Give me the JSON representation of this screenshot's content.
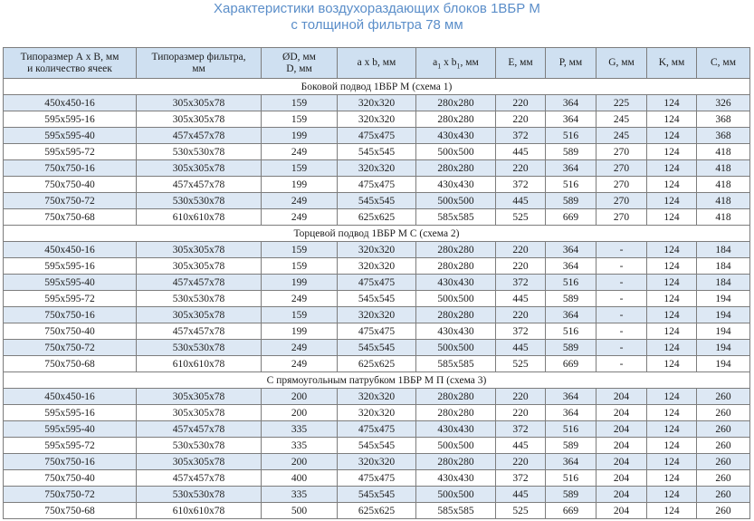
{
  "title": {
    "line1": "Характеристики воздухораздающих блоков 1ВБР М",
    "line2": "с толщиной фильтра 78 мм"
  },
  "colors": {
    "title": "#5b8ec9",
    "header_bg": "#cfe0f1",
    "stripe_bg": "#dde8f4",
    "border": "#7d7d7d"
  },
  "headers": {
    "size_line1": "Типоразмер А х В, мм",
    "size_line2": "и количество ячеек",
    "filter_line1": "Типоразмер фильтра,",
    "filter_line2": "мм",
    "d_line1": "ØD, мм",
    "d_line2": "D, мм",
    "ab": "a x b, мм",
    "a1b1_a": "a",
    "a1b1_sub1": "1",
    "a1b1_mid": " x b",
    "a1b1_sub2": "1",
    "a1b1_end": ", мм",
    "e": "E, мм",
    "p": "P, мм",
    "g": "G, мм",
    "k": "K, мм",
    "c": "C, мм"
  },
  "sections": [
    {
      "title": "Боковой подвод 1ВБР М (схема 1)",
      "rows": [
        [
          "450x450-16",
          "305x305x78",
          "159",
          "320x320",
          "280x280",
          "220",
          "364",
          "225",
          "124",
          "326"
        ],
        [
          "595x595-16",
          "305x305x78",
          "159",
          "320x320",
          "280x280",
          "220",
          "364",
          "245",
          "124",
          "368"
        ],
        [
          "595x595-40",
          "457x457x78",
          "199",
          "475x475",
          "430x430",
          "372",
          "516",
          "245",
          "124",
          "368"
        ],
        [
          "595x595-72",
          "530x530x78",
          "249",
          "545x545",
          "500x500",
          "445",
          "589",
          "270",
          "124",
          "418"
        ],
        [
          "750x750-16",
          "305x305x78",
          "159",
          "320x320",
          "280x280",
          "220",
          "364",
          "270",
          "124",
          "418"
        ],
        [
          "750x750-40",
          "457x457x78",
          "199",
          "475x475",
          "430x430",
          "372",
          "516",
          "270",
          "124",
          "418"
        ],
        [
          "750x750-72",
          "530x530x78",
          "249",
          "545x545",
          "500x500",
          "445",
          "589",
          "270",
          "124",
          "418"
        ],
        [
          "750x750-68",
          "610x610x78",
          "249",
          "625x625",
          "585x585",
          "525",
          "669",
          "270",
          "124",
          "418"
        ]
      ]
    },
    {
      "title": "Торцевой подвод 1ВБР М С (схема 2)",
      "rows": [
        [
          "450x450-16",
          "305x305x78",
          "159",
          "320x320",
          "280x280",
          "220",
          "364",
          "-",
          "124",
          "184"
        ],
        [
          "595x595-16",
          "305x305x78",
          "159",
          "320x320",
          "280x280",
          "220",
          "364",
          "-",
          "124",
          "184"
        ],
        [
          "595x595-40",
          "457x457x78",
          "199",
          "475x475",
          "430x430",
          "372",
          "516",
          "-",
          "124",
          "184"
        ],
        [
          "595x595-72",
          "530x530x78",
          "249",
          "545x545",
          "500x500",
          "445",
          "589",
          "-",
          "124",
          "194"
        ],
        [
          "750x750-16",
          "305x305x78",
          "159",
          "320x320",
          "280x280",
          "220",
          "364",
          "-",
          "124",
          "194"
        ],
        [
          "750x750-40",
          "457x457x78",
          "199",
          "475x475",
          "430x430",
          "372",
          "516",
          "-",
          "124",
          "194"
        ],
        [
          "750x750-72",
          "530x530x78",
          "249",
          "545x545",
          "500x500",
          "445",
          "589",
          "-",
          "124",
          "194"
        ],
        [
          "750x750-68",
          "610x610x78",
          "249",
          "625x625",
          "585x585",
          "525",
          "669",
          "-",
          "124",
          "194"
        ]
      ]
    },
    {
      "title": "С прямоугольным патрубком 1ВБР М П (схема 3)",
      "rows": [
        [
          "450x450-16",
          "305x305x78",
          "200",
          "320x320",
          "280x280",
          "220",
          "364",
          "204",
          "124",
          "260"
        ],
        [
          "595x595-16",
          "305x305x78",
          "200",
          "320x320",
          "280x280",
          "220",
          "364",
          "204",
          "124",
          "260"
        ],
        [
          "595x595-40",
          "457x457x78",
          "335",
          "475x475",
          "430x430",
          "372",
          "516",
          "204",
          "124",
          "260"
        ],
        [
          "595x595-72",
          "530x530x78",
          "335",
          "545x545",
          "500x500",
          "445",
          "589",
          "204",
          "124",
          "260"
        ],
        [
          "750x750-16",
          "305x305x78",
          "200",
          "320x320",
          "280x280",
          "220",
          "364",
          "204",
          "124",
          "260"
        ],
        [
          "750x750-40",
          "457x457x78",
          "400",
          "475x475",
          "430x430",
          "372",
          "516",
          "204",
          "124",
          "260"
        ],
        [
          "750x750-72",
          "530x530x78",
          "335",
          "545x545",
          "500x500",
          "445",
          "589",
          "204",
          "124",
          "260"
        ],
        [
          "750x750-68",
          "610x610x78",
          "500",
          "625x625",
          "585x585",
          "525",
          "669",
          "204",
          "124",
          "260"
        ]
      ]
    }
  ]
}
